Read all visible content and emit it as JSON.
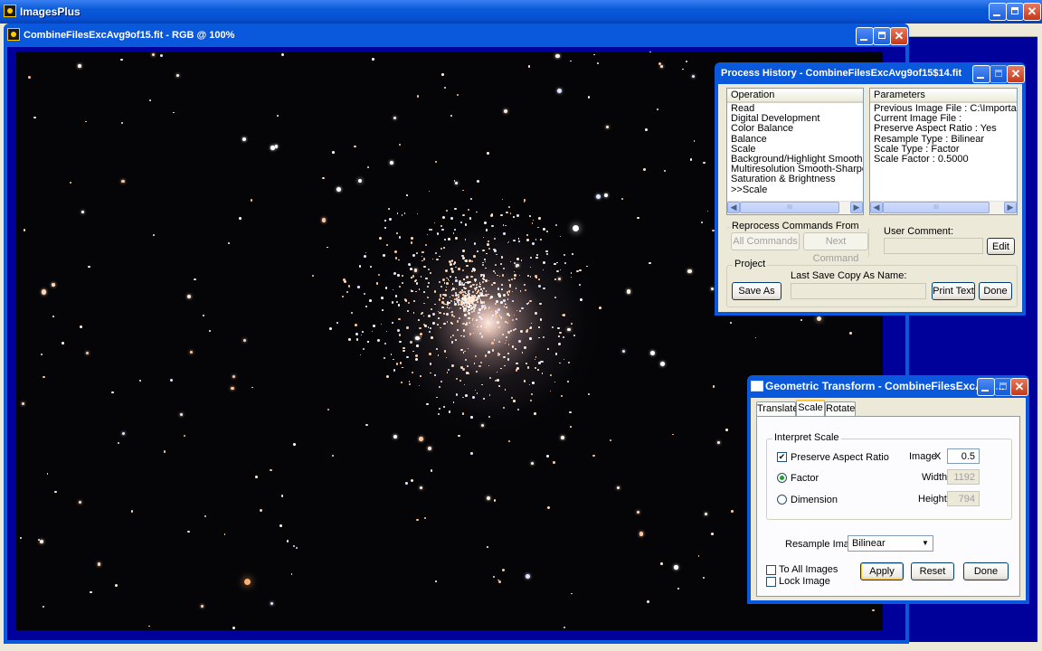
{
  "app": {
    "title": "ImagesPlus"
  },
  "image_window": {
    "title": "CombineFilesExcAvg9of15.fit - RGB @ 100%"
  },
  "process_history": {
    "title": "Process History - CombineFilesExcAvg9of15$14.fit",
    "operation_header": "Operation",
    "parameters_header": "Parameters",
    "operations": [
      "Read",
      "Digital Development",
      "Color Balance",
      "Balance",
      "Scale",
      "Background/Highlight Smoothing",
      "Multiresolution Smooth-Sharpen",
      "Saturation & Brightness",
      ">>Scale"
    ],
    "parameters": [
      "Previous Image File : C:\\Important Busin...",
      "Current Image File :",
      "Preserve Aspect Ratio : Yes",
      "Resample Type : Bilinear",
      "Scale Type : Factor",
      "Scale Factor : 0.5000"
    ],
    "scroll_mark": "III",
    "reprocess_label": "Reprocess Commands From Current >>",
    "all_commands": "All Commands",
    "next_command": "Next Command",
    "user_comment_label": "User Comment:",
    "edit": "Edit",
    "project_label": "Project",
    "last_save_label": "Last Save Copy As Name:",
    "save_as": "Save As",
    "print_text": "Print Text",
    "done": "Done"
  },
  "geometric_transform": {
    "title": "Geometric Transform - CombineFilesExcAvg...",
    "tabs": [
      "Translate",
      "Scale",
      "Rotate"
    ],
    "interpret_scale_label": "Interpret Scale",
    "preserve_aspect": "Preserve Aspect Ratio",
    "image_label": "Image",
    "x_label": "X",
    "x_value": "0.5",
    "factor": "Factor",
    "dimension": "Dimension",
    "width_label": "Width:",
    "width_value": "1192",
    "height_label": "Height:",
    "height_value": "794",
    "resample_label": "Resample Image:",
    "resample_value": "Bilinear",
    "to_all_images": "To All Images",
    "lock_image": "Lock Image",
    "apply": "Apply",
    "reset": "Reset",
    "done": "Done"
  },
  "glyphs": {
    "check": "✔",
    "close": "✕",
    "left": "◀",
    "right": "▶",
    "down": "▼"
  },
  "colors": {
    "title_blue": "#0a58dc",
    "sky": "#050508",
    "accent": "#ffc83c"
  }
}
